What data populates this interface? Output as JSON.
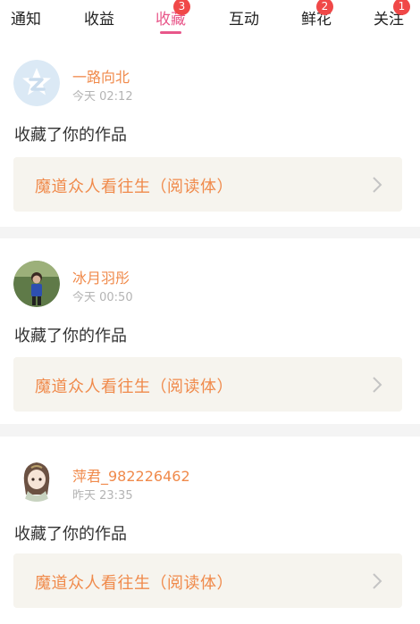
{
  "tabs": [
    {
      "label": "通知",
      "badge": ""
    },
    {
      "label": "收益",
      "badge": ""
    },
    {
      "label": "收藏",
      "badge": "3",
      "active": true
    },
    {
      "label": "互动",
      "badge": ""
    },
    {
      "label": "鲜花",
      "badge": "2"
    },
    {
      "label": "关注",
      "badge": "1"
    }
  ],
  "notifications": [
    {
      "username": "一路向北",
      "time": "今天 02:12",
      "action": "收藏了你的作品",
      "work_title": "魔道众人看往生（阅读体）",
      "avatar": "default-avatar-icon"
    },
    {
      "username": "冰月羽彤",
      "time": "今天 00:50",
      "action": "收藏了你的作品",
      "work_title": "魔道众人看往生（阅读体）",
      "avatar": "user-photo-avatar"
    },
    {
      "username": "萍君_982226462",
      "time": "昨天 23:35",
      "action": "收藏了你的作品",
      "work_title": "魔道众人看往生（阅读体）",
      "avatar": "anime-character-avatar"
    }
  ],
  "colors": {
    "accent": "#e8578a",
    "username": "#f08a4b",
    "badge": "#f04848",
    "card_bg": "#f6f4ee"
  }
}
